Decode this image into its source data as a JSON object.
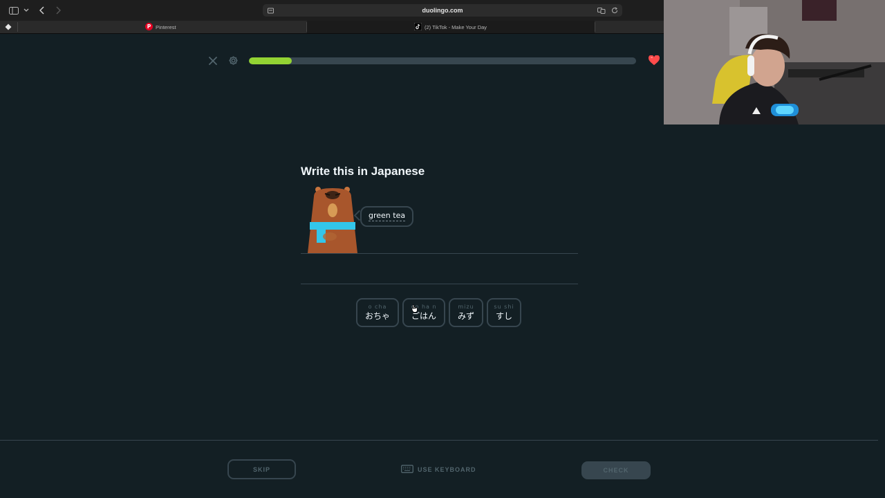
{
  "browser": {
    "url": "duolingo.com",
    "tabs": [
      {
        "label": "Pinterest",
        "icon": "pinterest-icon"
      },
      {
        "label": "(2) TikTok - Make Your Day",
        "icon": "tiktok-icon"
      }
    ]
  },
  "lesson": {
    "progress_fraction": 0.11,
    "title": "Write this in Japanese",
    "bubble_text": "green tea",
    "tiles": [
      {
        "reading": "o cha",
        "kana": "おちゃ"
      },
      {
        "reading": "go ha n",
        "kana": "ごはん"
      },
      {
        "reading": "mizu",
        "kana": "みず"
      },
      {
        "reading": "su shi",
        "kana": "すし"
      }
    ]
  },
  "footer": {
    "skip_label": "SKIP",
    "keyboard_label": "USE KEYBOARD",
    "check_label": "CHECK"
  },
  "colors": {
    "background": "#131f24",
    "progress": "#93d333",
    "border": "#37464f",
    "heart": "#ff4b4b",
    "scarf": "#1cb0f6"
  }
}
